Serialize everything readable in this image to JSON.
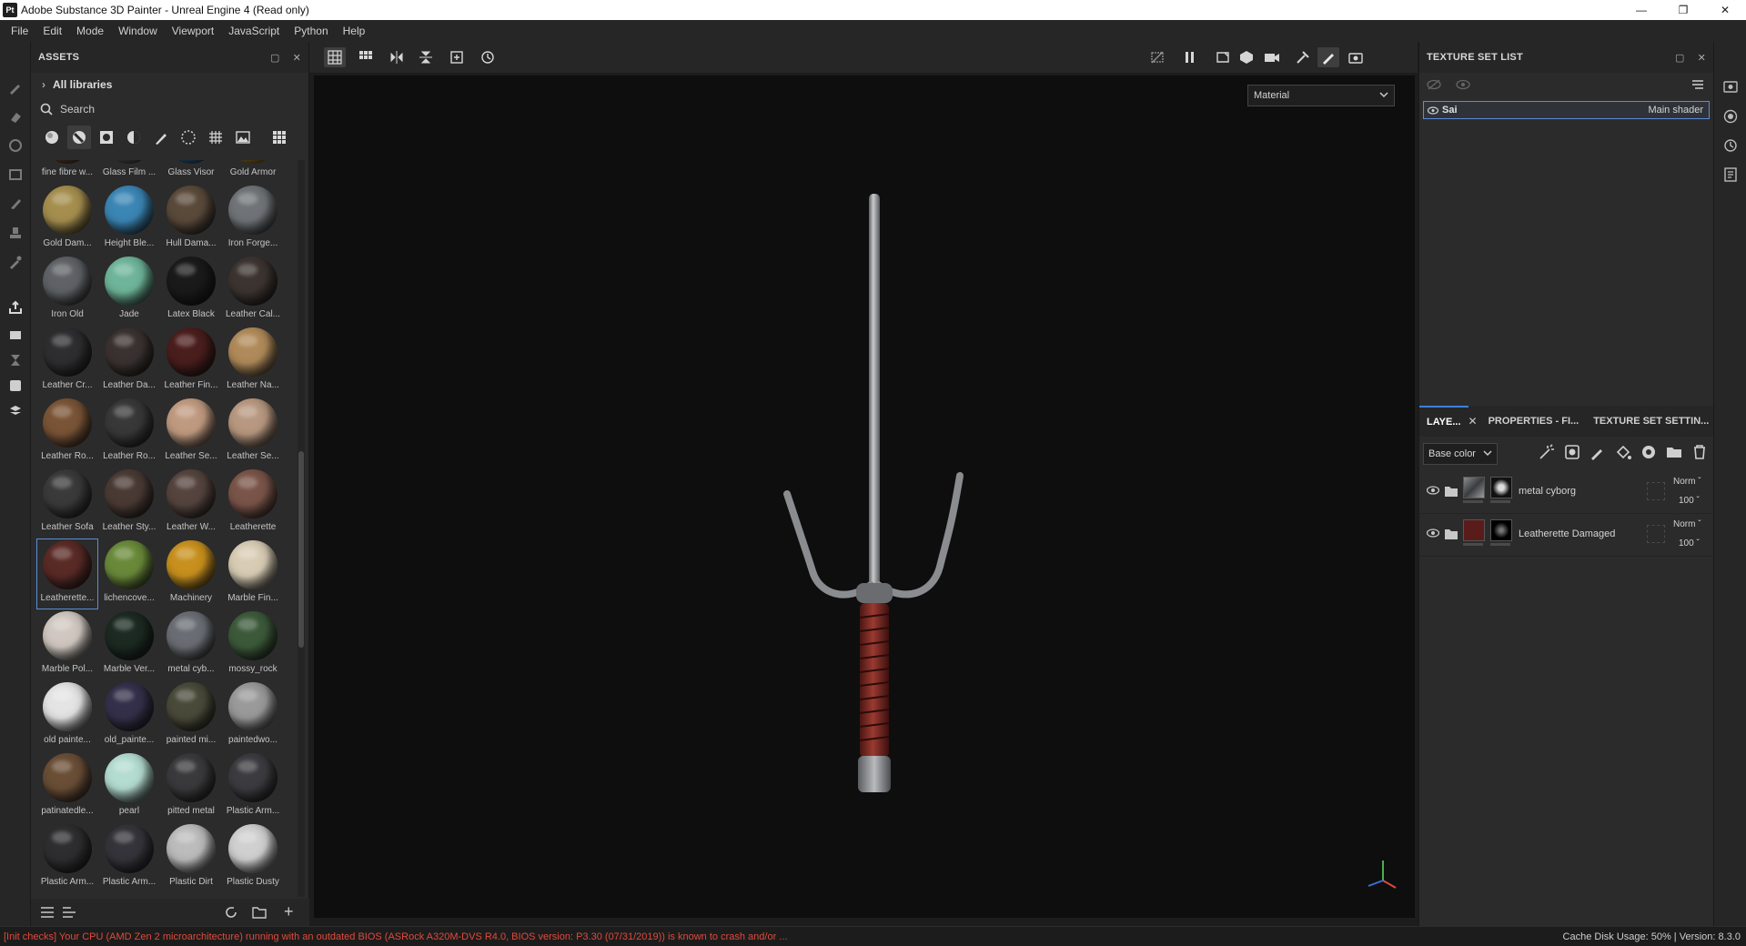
{
  "window": {
    "title": "Adobe Substance 3D Painter - Unreal Engine 4 (Read only)",
    "app_icon": "Pt"
  },
  "menu": [
    "File",
    "Edit",
    "Mode",
    "Window",
    "Viewport",
    "JavaScript",
    "Python",
    "Help"
  ],
  "assets": {
    "title": "ASSETS",
    "library": "All libraries",
    "search_placeholder": "Search",
    "items": [
      {
        "label": "fine fibre w...",
        "color": "#6b4a30"
      },
      {
        "label": "Glass Film ...",
        "color": "#5a5f63"
      },
      {
        "label": "Glass Visor",
        "color": "#2a6a9a"
      },
      {
        "label": "Gold Armor",
        "color": "#b08a2a"
      },
      {
        "label": "Gold Dam...",
        "color": "#a58e4e"
      },
      {
        "label": "Height Ble...",
        "color": "#3b86b5"
      },
      {
        "label": "Hull Dama...",
        "color": "#5a4a3a"
      },
      {
        "label": "Iron Forge...",
        "color": "#707478"
      },
      {
        "label": "Iron Old",
        "color": "#5f6266"
      },
      {
        "label": "Jade",
        "color": "#6fb59a"
      },
      {
        "label": "Latex Black",
        "color": "#1a1a1a"
      },
      {
        "label": "Leather Cal...",
        "color": "#3c3430"
      },
      {
        "label": "Leather Cr...",
        "color": "#2e2e30"
      },
      {
        "label": "Leather Da...",
        "color": "#3a3230"
      },
      {
        "label": "Leather Fin...",
        "color": "#4a1e1c"
      },
      {
        "label": "Leather Na...",
        "color": "#b08a5a"
      },
      {
        "label": "Leather Ro...",
        "color": "#7a5436"
      },
      {
        "label": "Leather Ro...",
        "color": "#383838"
      },
      {
        "label": "Leather Se...",
        "color": "#c09a80"
      },
      {
        "label": "Leather Se...",
        "color": "#b89880"
      },
      {
        "label": "Leather Sofa",
        "color": "#3a3a3a"
      },
      {
        "label": "Leather Sty...",
        "color": "#4a3a34"
      },
      {
        "label": "Leather W...",
        "color": "#55443e"
      },
      {
        "label": "Leatherette",
        "color": "#7a5448"
      },
      {
        "label": "Leatherette...",
        "color": "#5a2a26"
      },
      {
        "label": "lichencove...",
        "color": "#6a8a3a"
      },
      {
        "label": "Machinery",
        "color": "#c8901e"
      },
      {
        "label": "Marble Fin...",
        "color": "#d8ccb4"
      },
      {
        "label": "Marble Pol...",
        "color": "#d0c8c0"
      },
      {
        "label": "Marble Ver...",
        "color": "#1c2a22"
      },
      {
        "label": "metal cyb...",
        "color": "#6a6e74"
      },
      {
        "label": "mossy_rock",
        "color": "#3c5a3a"
      },
      {
        "label": "old painte...",
        "color": "#e4e4e4"
      },
      {
        "label": "old_painte...",
        "color": "#34304a"
      },
      {
        "label": "painted mi...",
        "color": "#4a4a3a"
      },
      {
        "label": "paintedwo...",
        "color": "#9a9a9a"
      },
      {
        "label": "patinatedle...",
        "color": "#6a4e36"
      },
      {
        "label": "pearl",
        "color": "#b4dcd0"
      },
      {
        "label": "pitted metal",
        "color": "#3a3a3c"
      },
      {
        "label": "Plastic Arm...",
        "color": "#3c3c40"
      },
      {
        "label": "Plastic Arm...",
        "color": "#2e2e30"
      },
      {
        "label": "Plastic Arm...",
        "color": "#34343a"
      },
      {
        "label": "Plastic Dirt",
        "color": "#bcbcbc"
      },
      {
        "label": "Plastic Dusty",
        "color": "#d0d0d0"
      }
    ]
  },
  "viewport": {
    "mode": "Material"
  },
  "texture_set_list": {
    "title": "TEXTURE SET LIST",
    "items": [
      {
        "name": "Sai",
        "shader": "Main shader"
      }
    ]
  },
  "layers": {
    "tabs": [
      "LAYE...",
      "PROPERTIES - FI...",
      "TEXTURE SET SETTIN..."
    ],
    "channel": "Base color",
    "items": [
      {
        "name": "metal cyborg",
        "blend": "Norm",
        "opacity": "100",
        "color": "#5a5c60"
      },
      {
        "name": "Leatherette Damaged",
        "blend": "Norm",
        "opacity": "100",
        "color": "#6a2220"
      }
    ]
  },
  "status": {
    "warning": "[Init checks] Your CPU (AMD Zen 2 microarchitecture) running with an outdated BIOS (ASRock A320M-DVS R4.0, BIOS version: P3.30 (07/31/2019)) is known to crash and/or ...",
    "cache": "Cache Disk Usage:   50% | Version: 8.3.0"
  },
  "colors": {
    "accent": "#3c82dc",
    "warning": "#e04a3c",
    "selection": "#5b8dd6"
  }
}
